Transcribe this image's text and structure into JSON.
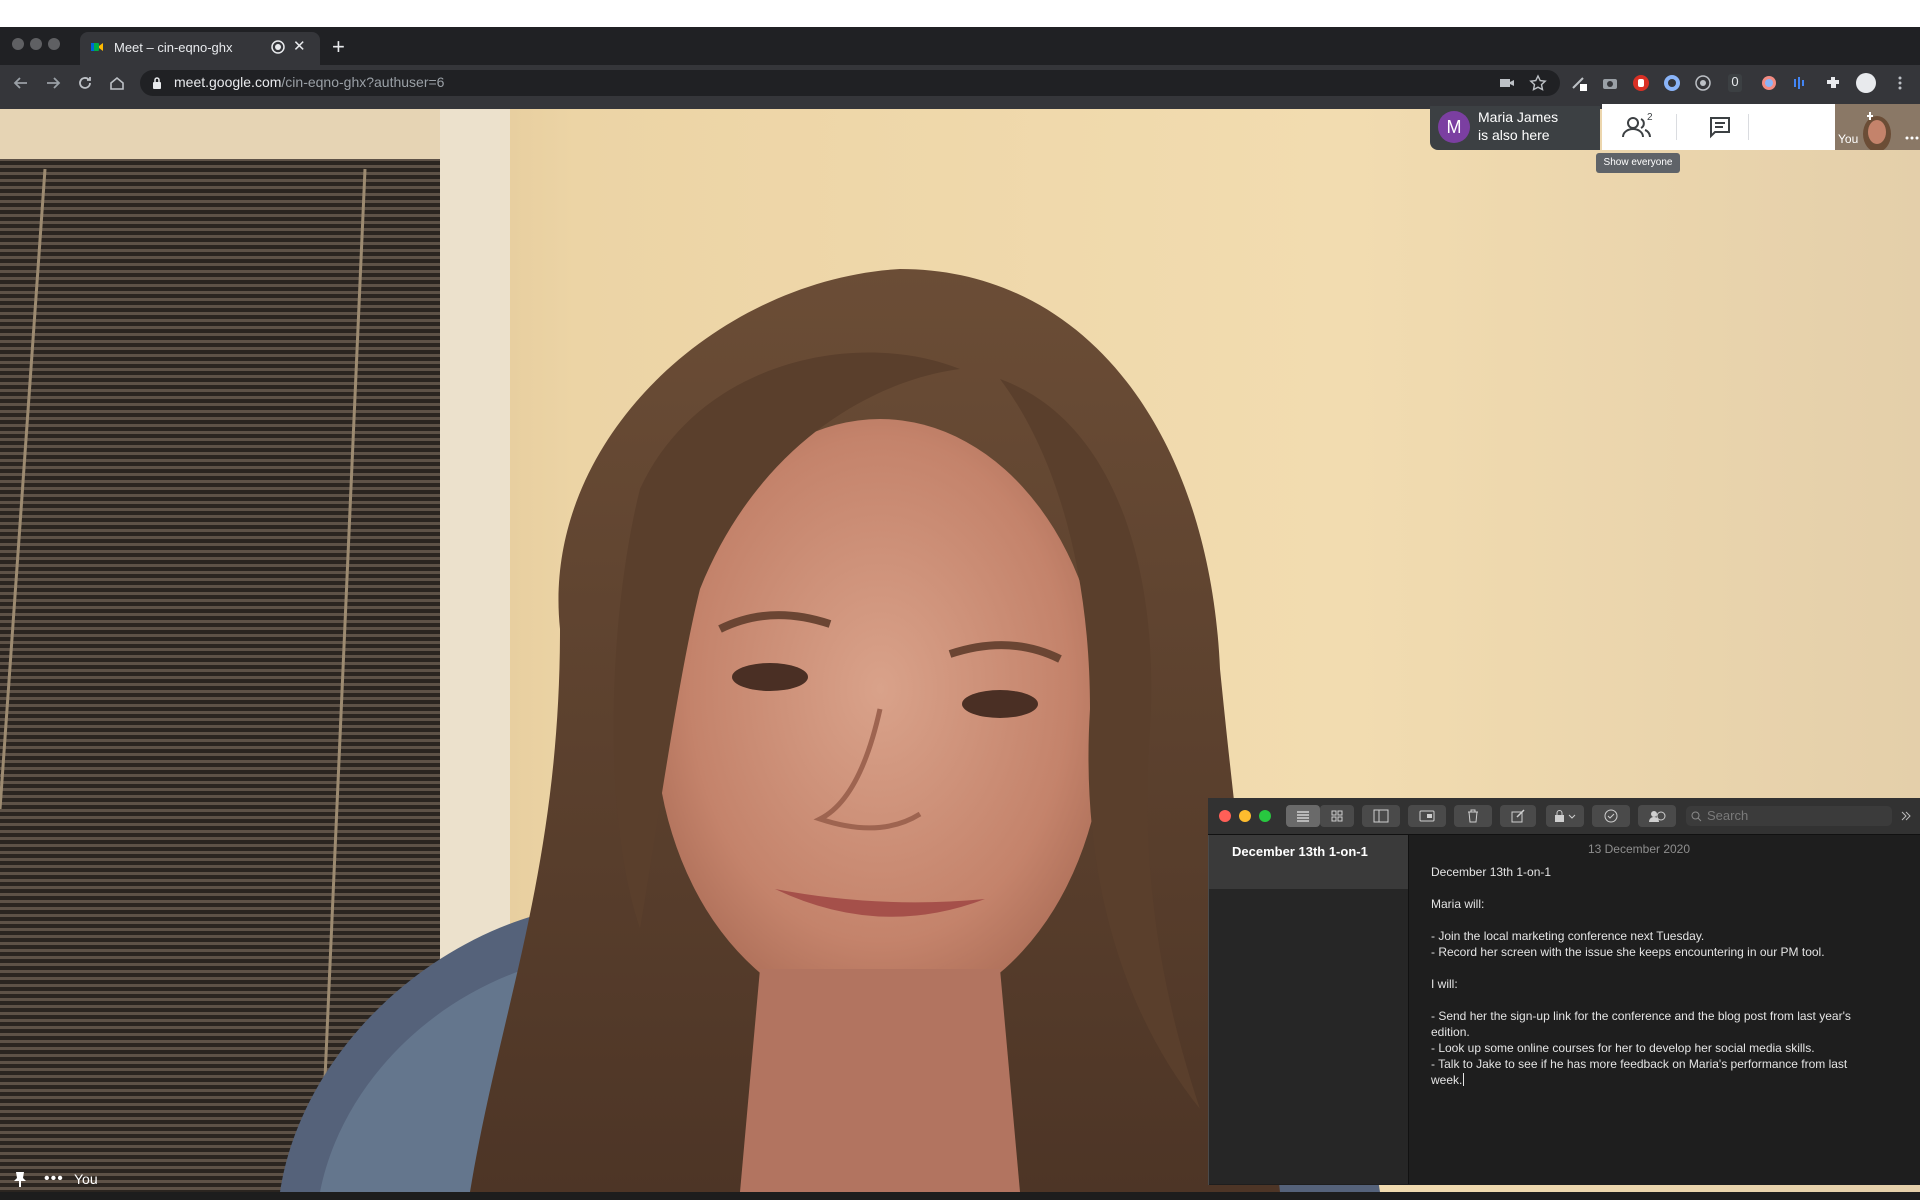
{
  "browser": {
    "tab_title": "Meet – cin-eqno-ghx",
    "url_host": "meet.google.com",
    "url_path": "/cin-eqno-ghx?authuser=6",
    "new_tab_symbol": "+",
    "tab_close_symbol": "✕",
    "extension_badge": "0"
  },
  "meet": {
    "notice_avatar_letter": "M",
    "notice_line1": "Maria James",
    "notice_line2": "is also here",
    "people_count": "2",
    "tooltip": "Show everyone",
    "self_label": "You",
    "bottom_name": "You",
    "bottom_more": "•••"
  },
  "notes": {
    "search_placeholder": "Search",
    "selected_note_title": "December 13th 1-on-1",
    "date": "13 December 2020",
    "lines": [
      "December 13th 1-on-1",
      "",
      "Maria will:",
      "",
      "- Join the local marketing conference next Tuesday.",
      "- Record her screen with the issue she keeps encountering in our PM tool.",
      "",
      "I will:",
      "",
      "- Send her the sign-up link for the conference and the blog post from last year's",
      "edition.",
      "- Look up some online courses for her to develop her social media skills.",
      "- Talk to Jake to see if he has more feedback on Maria's performance from last",
      "week."
    ]
  },
  "colors": {
    "chrome_bg": "#35363a",
    "meet_notice_bg": "#3c4043",
    "avatar_purple": "#7b3fa1",
    "notes_bg": "#1e1e1e",
    "close_red": "#ff5f57",
    "minimize_yellow": "#febc2e",
    "zoom_green": "#28c840"
  }
}
